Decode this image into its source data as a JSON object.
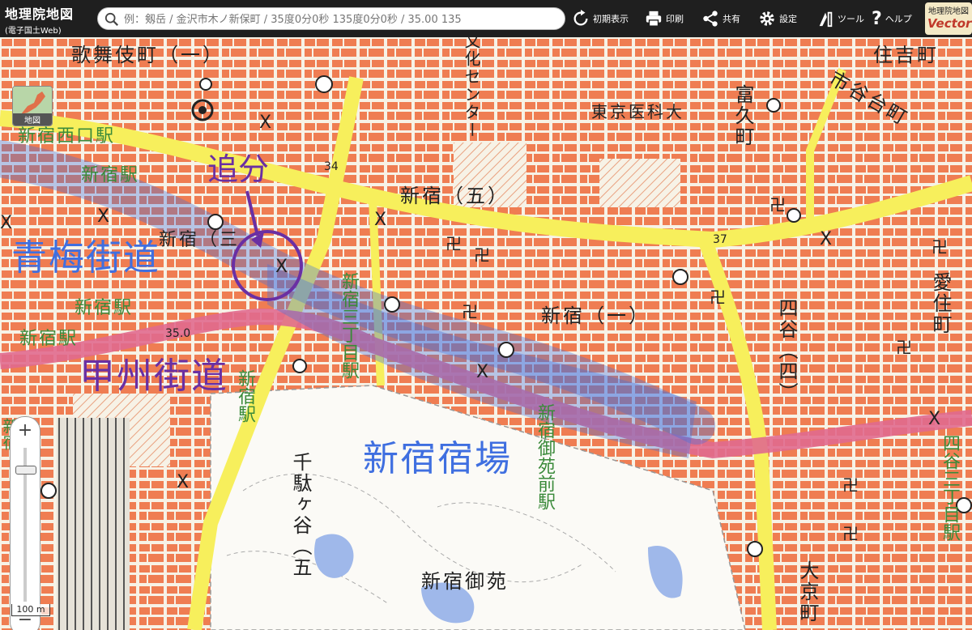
{
  "header": {
    "brand_title": "地理院地図",
    "brand_subtitle": "(電子国土Web)",
    "search_placeholder": "例：剱岳 / 金沢市木ノ新保町 / 35度0分0秒 135度0分0秒 / 35.00 135",
    "buttons": [
      {
        "label": "初期表示",
        "icon": "refresh-icon"
      },
      {
        "label": "印刷",
        "icon": "printer-icon"
      },
      {
        "label": "共有",
        "icon": "share-icon"
      },
      {
        "label": "設定",
        "icon": "gear-icon"
      },
      {
        "label": "ツール",
        "icon": "tool-icon"
      },
      {
        "label": "ヘルプ",
        "icon": "help-icon"
      }
    ],
    "logo_top": "地理院地図",
    "logo_bottom": "Vector"
  },
  "map": {
    "layer_button_label": "地図",
    "scale_label": "100 m",
    "colors": {
      "building": "#ef7d52",
      "road": "#f7ef5c",
      "highlight_blue": "#3f6fe0",
      "highlight_pink": "#e06a8e",
      "annotation_purple": "#6a2fa3",
      "station_green": "#3a8a3a"
    },
    "labels": {
      "kabukicho": "歌舞伎町（一）",
      "sumiyoshi": "住吉町",
      "ichigaya": "市谷台町",
      "tokyo_medical": "東京医科大",
      "tomihisa": "富久町",
      "bunka_center": "文化センター",
      "shinjuku5": "新宿（五）",
      "shinjuku1": "新宿（一）",
      "yotsuya4": "四谷（四）",
      "aizumi": "愛住町",
      "shinjuku_gyoen": "新宿御苑",
      "sendagaya": "千駄ヶ谷（五",
      "daikyo": "大京町",
      "shinjuku_san": "新宿（三",
      "route34": "34",
      "route37": "37",
      "route35": "35.0"
    },
    "stations": {
      "nishiguchi": "新宿西口駅",
      "shinjuku_a": "新宿駅",
      "shinjuku_b": "新宿駅",
      "shinjuku_c": "新宿駅",
      "sanchome": "新宿三丁目駅",
      "gyoenmae": "新宿御苑前駅",
      "yotsuya_sanchome": "四谷三丁目駅",
      "shinjuku_d": "新宿駅",
      "shinjuku_short": "新宿"
    },
    "annotations": {
      "oiwake": "追分",
      "ome_kaido": "青梅街道",
      "koshu_kaido": "甲州街道",
      "shinjuku_shukuba": "新宿宿場"
    }
  }
}
